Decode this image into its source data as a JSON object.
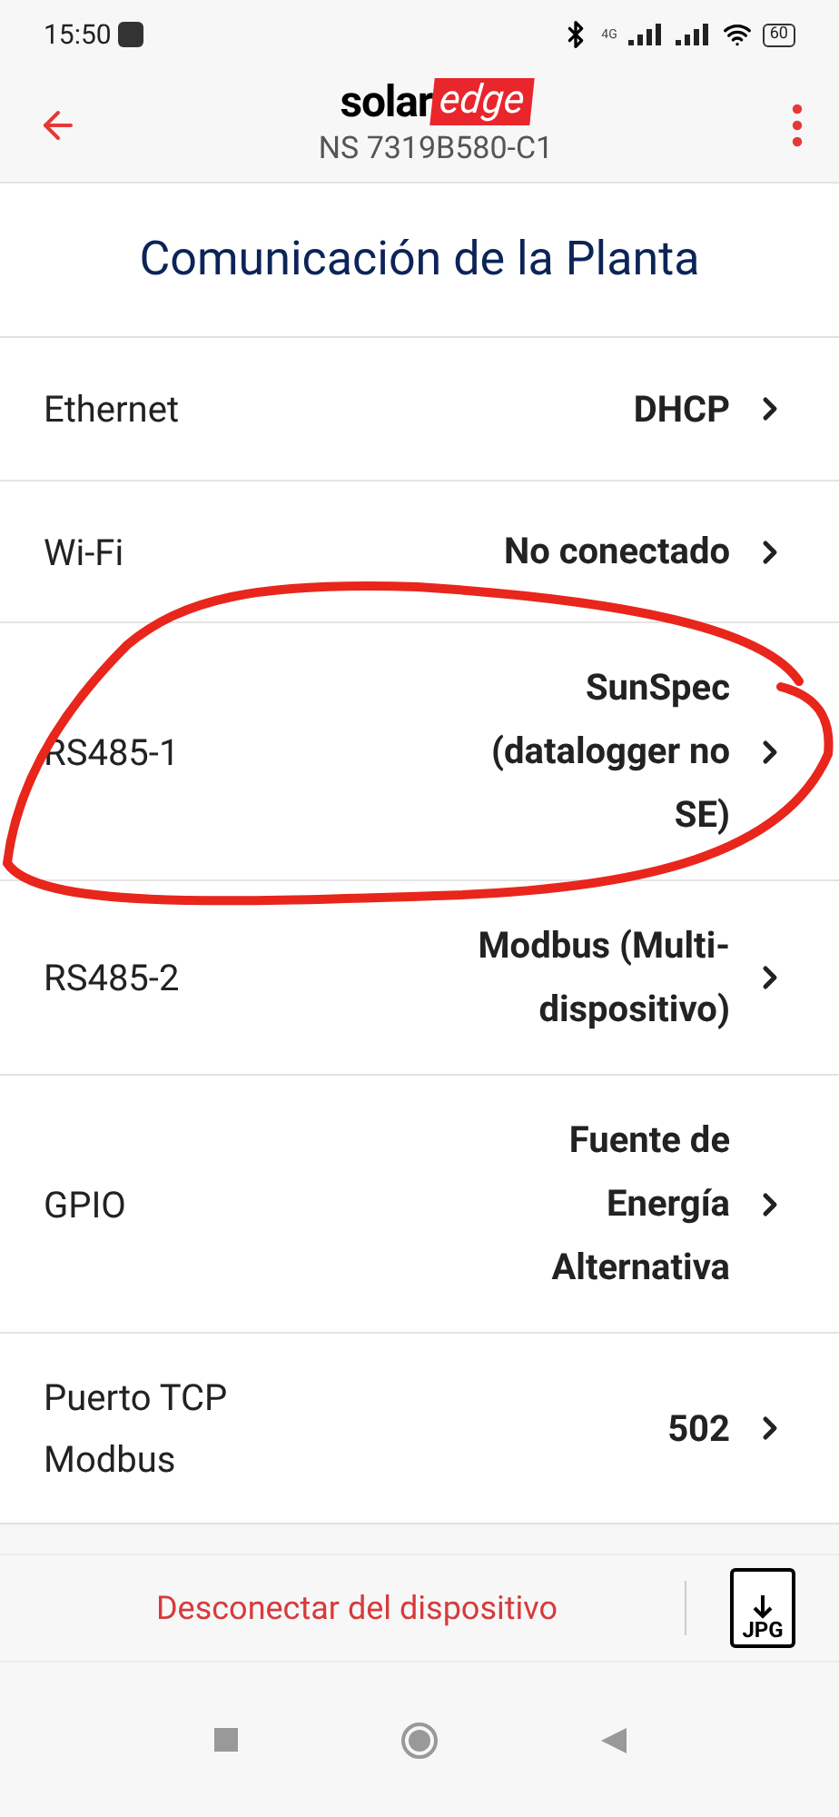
{
  "status_bar": {
    "time": "15:50",
    "network": "4G",
    "battery": "60"
  },
  "header": {
    "logo": {
      "part_1": "solar",
      "part_2": "edge"
    },
    "subtitle": "NS 7319B580-C1"
  },
  "title": "Comunicación de la Planta",
  "settings": [
    {
      "label": "Ethernet",
      "value": "DHCP"
    },
    {
      "label": "Wi-Fi",
      "value": "No conectado"
    },
    {
      "label": "RS485-1",
      "value": "SunSpec (datalogger no SE)"
    },
    {
      "label": "RS485-2",
      "value": "Modbus (Multi-dispositivo)"
    },
    {
      "label": "GPIO",
      "value": "Fuente de Energía Alternativa"
    },
    {
      "label": "Puerto TCP Modbus",
      "value": "502"
    }
  ],
  "footer": {
    "disconnect": "Desconectar del dispositivo",
    "export_label": "JPG"
  },
  "annotation": {
    "kind": "ellipse",
    "color": "#e8261c"
  }
}
